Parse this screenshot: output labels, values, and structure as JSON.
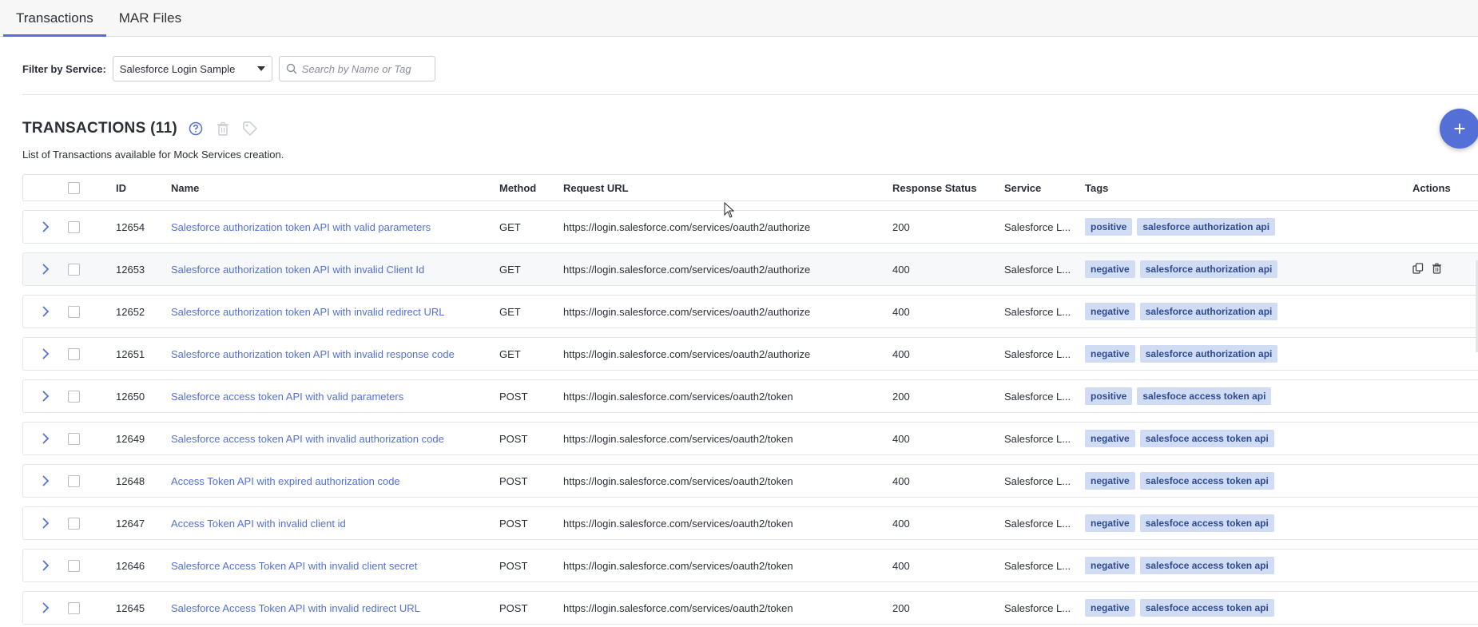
{
  "tabs": [
    {
      "label": "Transactions",
      "active": true
    },
    {
      "label": "MAR Files",
      "active": false
    }
  ],
  "filter": {
    "label": "Filter by Service:",
    "selected_service": "Salesforce Login Sample",
    "search_placeholder": "Search by Name or Tag"
  },
  "section": {
    "title": "TRANSACTIONS (11)",
    "subtitle": "List of Transactions available for Mock Services creation."
  },
  "icons": {
    "help": "help-circle-icon",
    "delete": "trash-icon",
    "tag": "tag-icon",
    "add": "plus-icon",
    "expand": "chevron-right-icon",
    "copy": "copy-icon"
  },
  "colors": {
    "accent": "#5470d6",
    "tag_bg": "#cfdcf4",
    "tag_text": "#2f4a8f"
  },
  "table": {
    "columns": {
      "id": "ID",
      "name": "Name",
      "method": "Method",
      "url": "Request URL",
      "status": "Response Status",
      "service": "Service",
      "tags": "Tags",
      "actions": "Actions"
    },
    "rows": [
      {
        "id": "12654",
        "name": "Salesforce authorization token API with valid parameters",
        "method": "GET",
        "url": "https://login.salesforce.com/services/oauth2/authorize",
        "status": "200",
        "service": "Salesforce L...",
        "tags": [
          "positive",
          "salesforce authorization api"
        ]
      },
      {
        "id": "12653",
        "name": "Salesforce authorization token API with invalid Client Id",
        "method": "GET",
        "url": "https://login.salesforce.com/services/oauth2/authorize",
        "status": "400",
        "service": "Salesforce L...",
        "tags": [
          "negative",
          "salesforce authorization api"
        ]
      },
      {
        "id": "12652",
        "name": "Salesforce authorization token API with invalid redirect URL",
        "method": "GET",
        "url": "https://login.salesforce.com/services/oauth2/authorize",
        "status": "400",
        "service": "Salesforce L...",
        "tags": [
          "negative",
          "salesforce authorization api"
        ]
      },
      {
        "id": "12651",
        "name": "Salesforce authorization token API with invalid response code",
        "method": "GET",
        "url": "https://login.salesforce.com/services/oauth2/authorize",
        "status": "400",
        "service": "Salesforce L...",
        "tags": [
          "negative",
          "salesforce authorization api"
        ]
      },
      {
        "id": "12650",
        "name": "Salesforce access token API with valid parameters",
        "method": "POST",
        "url": "https://login.salesforce.com/services/oauth2/token",
        "status": "200",
        "service": "Salesforce L...",
        "tags": [
          "positive",
          "salesfoce access token api"
        ]
      },
      {
        "id": "12649",
        "name": "Salesforce access token API with invalid authorization code",
        "method": "POST",
        "url": "https://login.salesforce.com/services/oauth2/token",
        "status": "400",
        "service": "Salesforce L...",
        "tags": [
          "negative",
          "salesfoce access token api"
        ]
      },
      {
        "id": "12648",
        "name": "Access Token API with expired authorization code",
        "method": "POST",
        "url": "https://login.salesforce.com/services/oauth2/token",
        "status": "400",
        "service": "Salesforce L...",
        "tags": [
          "negative",
          "salesfoce access token api"
        ]
      },
      {
        "id": "12647",
        "name": "Access Token API with invalid client id",
        "method": "POST",
        "url": "https://login.salesforce.com/services/oauth2/token",
        "status": "400",
        "service": "Salesforce L...",
        "tags": [
          "negative",
          "salesfoce access token api"
        ]
      },
      {
        "id": "12646",
        "name": "Salesforce Access Token API with invalid client secret",
        "method": "POST",
        "url": "https://login.salesforce.com/services/oauth2/token",
        "status": "400",
        "service": "Salesforce L...",
        "tags": [
          "negative",
          "salesfoce access token api"
        ]
      },
      {
        "id": "12645",
        "name": "Salesforce Access Token API with invalid redirect URL",
        "method": "POST",
        "url": "https://login.salesforce.com/services/oauth2/token",
        "status": "200",
        "service": "Salesforce L...",
        "tags": [
          "negative",
          "salesfoce access token api"
        ]
      }
    ]
  }
}
